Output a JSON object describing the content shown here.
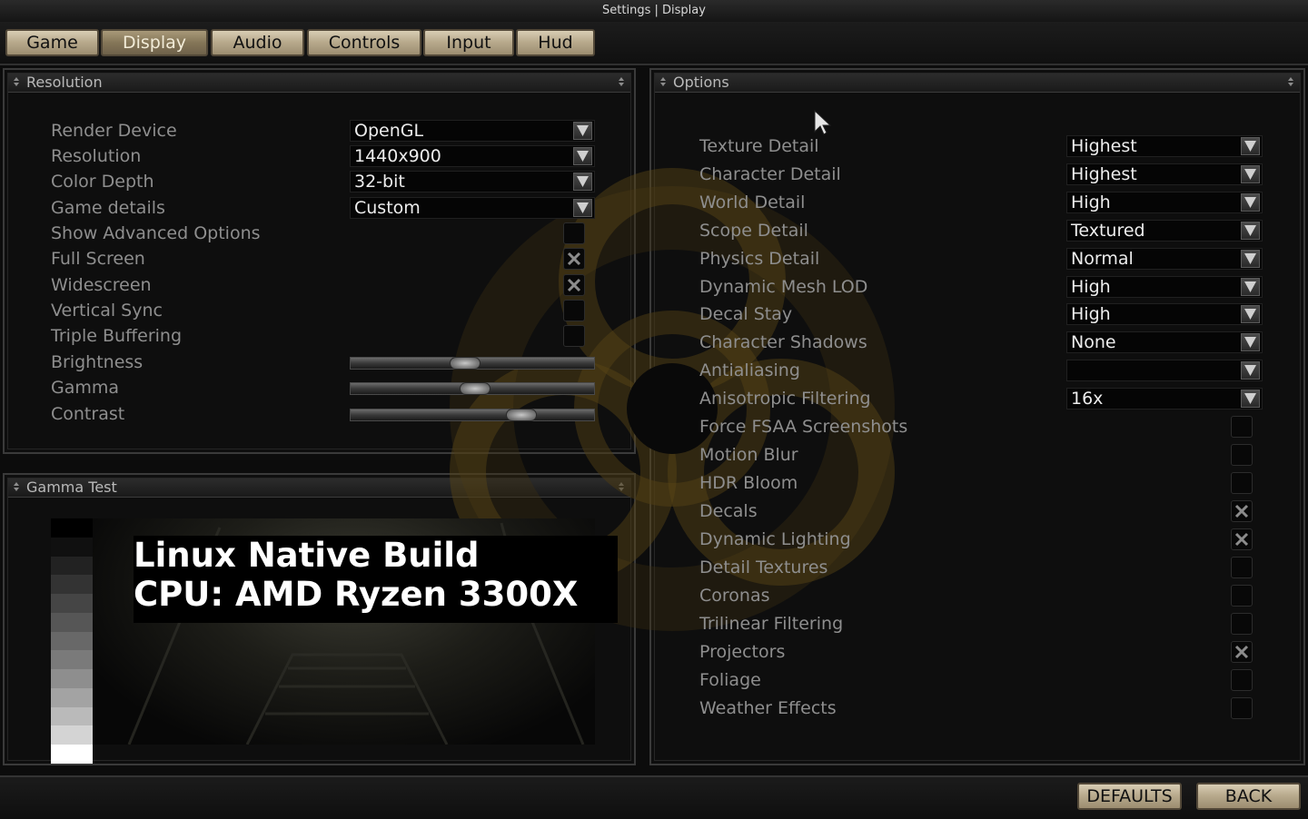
{
  "window": {
    "title": "Settings | Display"
  },
  "tabs": [
    {
      "label": "Game",
      "active": false
    },
    {
      "label": "Display",
      "active": true
    },
    {
      "label": "Audio",
      "active": false
    },
    {
      "label": "Controls",
      "active": false
    },
    {
      "label": "Input",
      "active": false
    },
    {
      "label": "Hud",
      "active": false
    }
  ],
  "resolution_panel": {
    "title": "Resolution",
    "dropdowns": [
      {
        "label": "Render Device",
        "value": "OpenGL"
      },
      {
        "label": "Resolution",
        "value": "1440x900"
      },
      {
        "label": "Color Depth",
        "value": "32-bit"
      },
      {
        "label": "Game details",
        "value": "Custom"
      }
    ],
    "checkboxes": [
      {
        "label": "Show Advanced Options",
        "checked": false
      },
      {
        "label": "Full Screen",
        "checked": true
      },
      {
        "label": "Widescreen",
        "checked": true
      },
      {
        "label": "Vertical Sync",
        "checked": false
      },
      {
        "label": "Triple Buffering",
        "checked": false
      }
    ],
    "sliders": [
      {
        "label": "Brightness",
        "value": 0.47
      },
      {
        "label": "Gamma",
        "value": 0.51
      },
      {
        "label": "Contrast",
        "value": 0.7
      }
    ]
  },
  "gamma_panel": {
    "title": "Gamma Test",
    "overlay_lines": [
      "Linux Native Build",
      "CPU: AMD Ryzen 3300X"
    ],
    "gray_steps": [
      "#000000",
      "#101010",
      "#222222",
      "#333333",
      "#454545",
      "#565656",
      "#686868",
      "#7a7a7a",
      "#8e8e8e",
      "#a3a3a3",
      "#bababa",
      "#d4d4d4",
      "#ffffff"
    ]
  },
  "options_panel": {
    "title": "Options",
    "dropdowns": [
      {
        "label": "Texture Detail",
        "value": "Highest"
      },
      {
        "label": "Character Detail",
        "value": "Highest"
      },
      {
        "label": "World Detail",
        "value": "High"
      },
      {
        "label": "Scope Detail",
        "value": "Textured"
      },
      {
        "label": "Physics Detail",
        "value": "Normal"
      },
      {
        "label": "Dynamic Mesh LOD",
        "value": "High"
      },
      {
        "label": "Decal Stay",
        "value": "High"
      },
      {
        "label": "Character Shadows",
        "value": "None"
      },
      {
        "label": "Antialiasing",
        "value": ""
      },
      {
        "label": "Anisotropic Filtering",
        "value": "16x"
      }
    ],
    "checkboxes": [
      {
        "label": "Force FSAA Screenshots",
        "checked": false
      },
      {
        "label": "Motion Blur",
        "checked": false
      },
      {
        "label": "HDR Bloom",
        "checked": false
      },
      {
        "label": "Decals",
        "checked": true
      },
      {
        "label": "Dynamic Lighting",
        "checked": true
      },
      {
        "label": "Detail Textures",
        "checked": false
      },
      {
        "label": "Coronas",
        "checked": false
      },
      {
        "label": "Trilinear Filtering",
        "checked": false
      },
      {
        "label": "Projectors",
        "checked": true
      },
      {
        "label": "Foliage",
        "checked": false
      },
      {
        "label": "Weather Effects",
        "checked": false
      }
    ]
  },
  "footer": {
    "defaults_label": "DEFAULTS",
    "back_label": "BACK"
  },
  "colors": {
    "button_face": "#b9ab8e",
    "active_tab": "#857658",
    "watermark": "#8a6a1a"
  }
}
